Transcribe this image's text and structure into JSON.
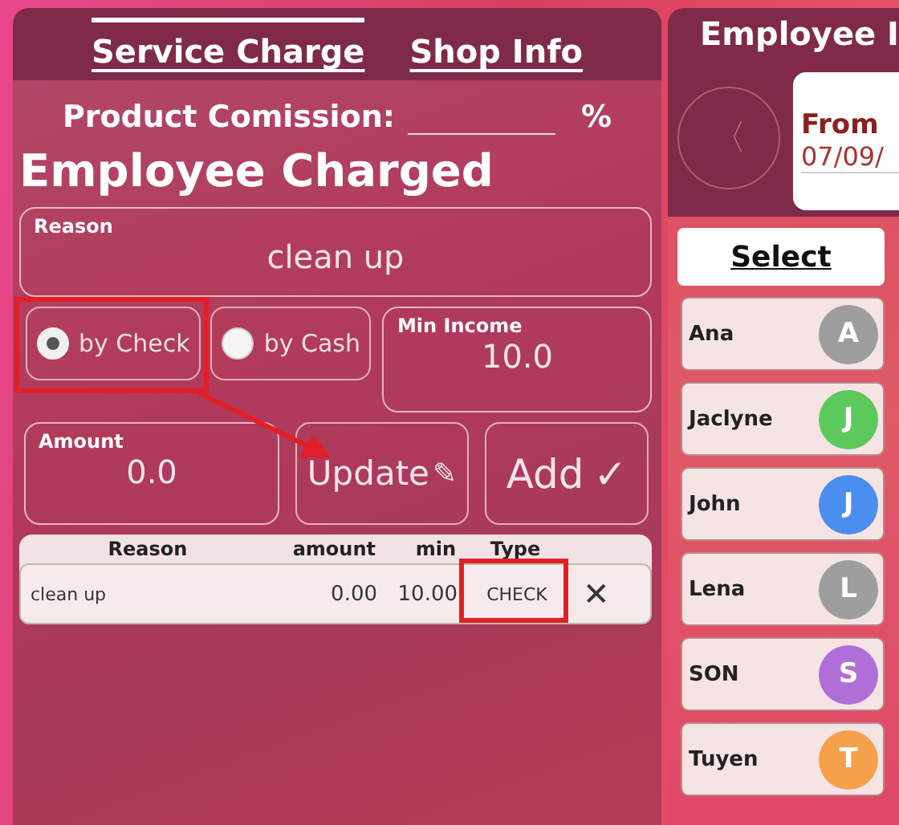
{
  "tabs": [
    {
      "label": "Service Charge",
      "selected": true
    },
    {
      "label": "Shop Info",
      "selected": false
    }
  ],
  "commission": {
    "label": "Product Comission:",
    "unit": "%"
  },
  "heading": "Employee Charged",
  "reason": {
    "label": "Reason",
    "value": "clean up"
  },
  "payment_options": [
    {
      "label": "by Check",
      "selected": true,
      "highlighted": true
    },
    {
      "label": "by Cash",
      "selected": false,
      "highlighted": false
    }
  ],
  "min_income": {
    "label": "Min Income",
    "value": "10.0"
  },
  "amount": {
    "label": "Amount",
    "value": "0.0"
  },
  "buttons": [
    {
      "kind": "update",
      "label": "Update",
      "icon": "✎"
    },
    {
      "kind": "add",
      "label": "Add",
      "icon": "✓"
    }
  ],
  "table": {
    "columns": [
      "Reason",
      "amount",
      "min",
      "Type"
    ],
    "rows": [
      {
        "reason": "clean up",
        "amount": "0.00",
        "min": "10.00",
        "type": "CHECK",
        "type_highlighted": true,
        "remove": "✕"
      }
    ]
  },
  "right_panel": {
    "title": "Employee I",
    "back": "〈",
    "from_label": "From",
    "from_value": "07/09/",
    "select": "Select",
    "employees": [
      {
        "name": "Ana",
        "initial": "A",
        "color": "#9e9e9e"
      },
      {
        "name": "Jaclyne",
        "initial": "J",
        "color": "#5cc95c"
      },
      {
        "name": "John",
        "initial": "J",
        "color": "#4a8fef"
      },
      {
        "name": "Lena",
        "initial": "L",
        "color": "#9e9e9e"
      },
      {
        "name": "SON",
        "initial": "S",
        "color": "#b06fd6"
      },
      {
        "name": "Tuyen",
        "initial": "T",
        "color": "#f5a04a"
      }
    ]
  }
}
